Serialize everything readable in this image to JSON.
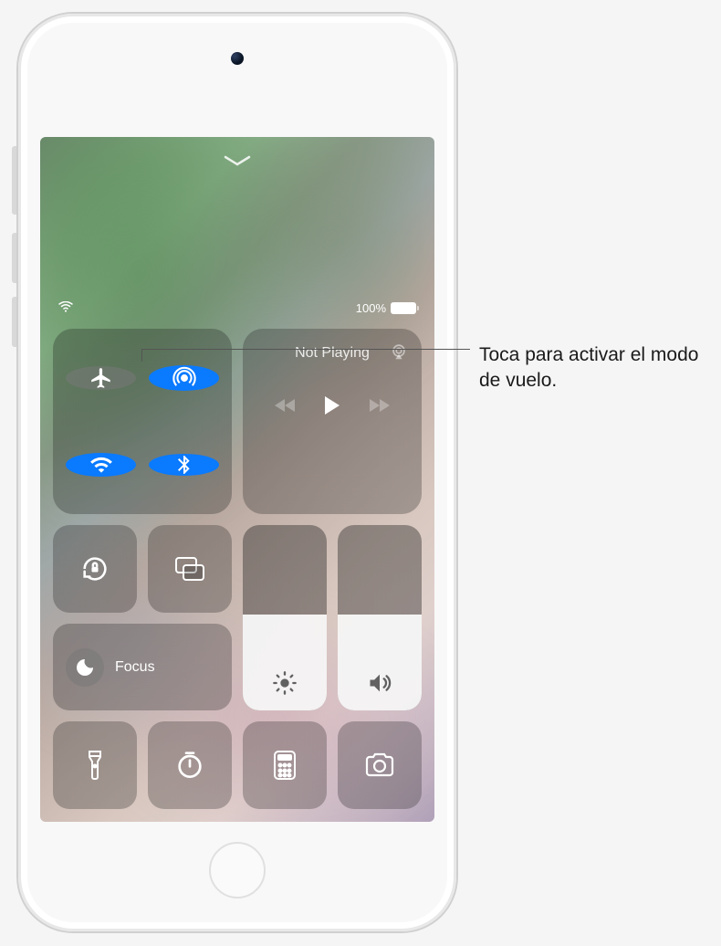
{
  "statusBar": {
    "batteryPercent": "100%"
  },
  "connectivity": {
    "airplane": {
      "active": false
    },
    "airdrop": {
      "active": true
    },
    "wifi": {
      "active": true
    },
    "bluetooth": {
      "active": true
    }
  },
  "media": {
    "status": "Not Playing"
  },
  "focus": {
    "label": "Focus"
  },
  "brightness": {
    "level": 0.52
  },
  "volume": {
    "level": 0.52
  },
  "annotation": {
    "text": "Toca para activar el modo de vuelo."
  }
}
